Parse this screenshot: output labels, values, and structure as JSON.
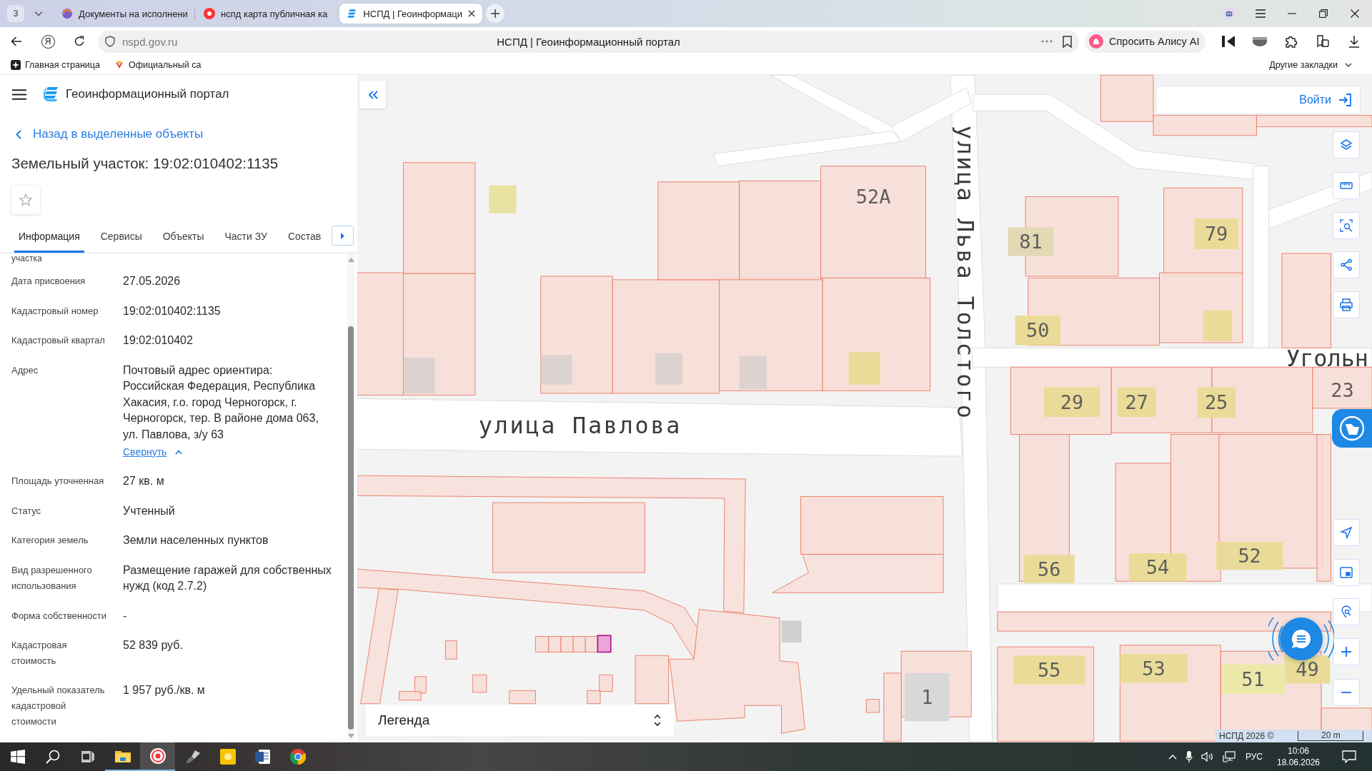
{
  "browser": {
    "tab_counter": "3",
    "tabs": [
      {
        "title": "Документы на исполнени",
        "selected": false
      },
      {
        "title": "нспд карта публичная ка",
        "selected": false
      },
      {
        "title": "НСПД | Геоинформаци",
        "selected": true
      }
    ],
    "home_button": "Я",
    "address": "nspd.gov.ru",
    "page_title": "НСПД | Геоинформационный портал",
    "alice_button": "Спросить Алису AI",
    "bookmarks": [
      "Главная страница",
      "Официальный са"
    ],
    "other_bookmarks": "Другие закладки"
  },
  "portal": {
    "title": "Геоинформационный портал",
    "login_button": "Войти"
  },
  "panel": {
    "back_link": "Назад в выделенные объекты",
    "title": "Земельный участок: 19:02:010402:1135",
    "tabs": [
      {
        "label": "Информация",
        "selected": true
      },
      {
        "label": "Сервисы",
        "selected": false
      },
      {
        "label": "Объекты",
        "selected": false
      },
      {
        "label": "Части ЗУ",
        "selected": false
      },
      {
        "label": "Состав",
        "selected": false
      }
    ],
    "cut_label": "участка",
    "fields": [
      {
        "label": "Дата присвоения",
        "value": "27.05.2026"
      },
      {
        "label": "Кадастровый номер",
        "value": "19:02:010402:1135"
      },
      {
        "label": "Кадастровый квартал",
        "value": "19:02:010402"
      },
      {
        "label": "Адрес",
        "value": "Почтовый адрес ориентира: Российская Федерация, Республика Хакасия, г.о. город Черногорск, г. Черногорск, тер. В районе дома 063, ул. Павлова, з/у 63",
        "link": "Свернуть"
      },
      {
        "label": "Площадь уточненная",
        "value": "27 кв. м"
      },
      {
        "label": "Статус",
        "value": "Учтенный"
      },
      {
        "label": "Категория земель",
        "value": "Земли населенных пунктов"
      },
      {
        "label": "Вид разрешенного использования",
        "value": "Размещение гаражей для собственных нужд (код 2.7.2)"
      },
      {
        "label": "Форма собственности",
        "value": "-"
      },
      {
        "label": "Кадастровая стоимость",
        "value": "52 839 руб."
      },
      {
        "label": "Удельный показатель кадастровой стоимости",
        "value": "1 957 руб./кв. м"
      }
    ]
  },
  "map": {
    "street_names": [
      "улица Павлова",
      "улица Льва Толстого",
      "Угольн"
    ],
    "house_numbers": [
      "52А",
      "81",
      "79",
      "50",
      "29",
      "27",
      "25",
      "23",
      "56",
      "54",
      "52",
      "55",
      "53",
      "51",
      "49",
      "1"
    ],
    "legend": "Легенда",
    "attribution": "НСПД 2026 ©",
    "scale": "20 m"
  },
  "taskbar": {
    "language": "РУС",
    "time": "10:06",
    "date": "18.06.2026"
  }
}
